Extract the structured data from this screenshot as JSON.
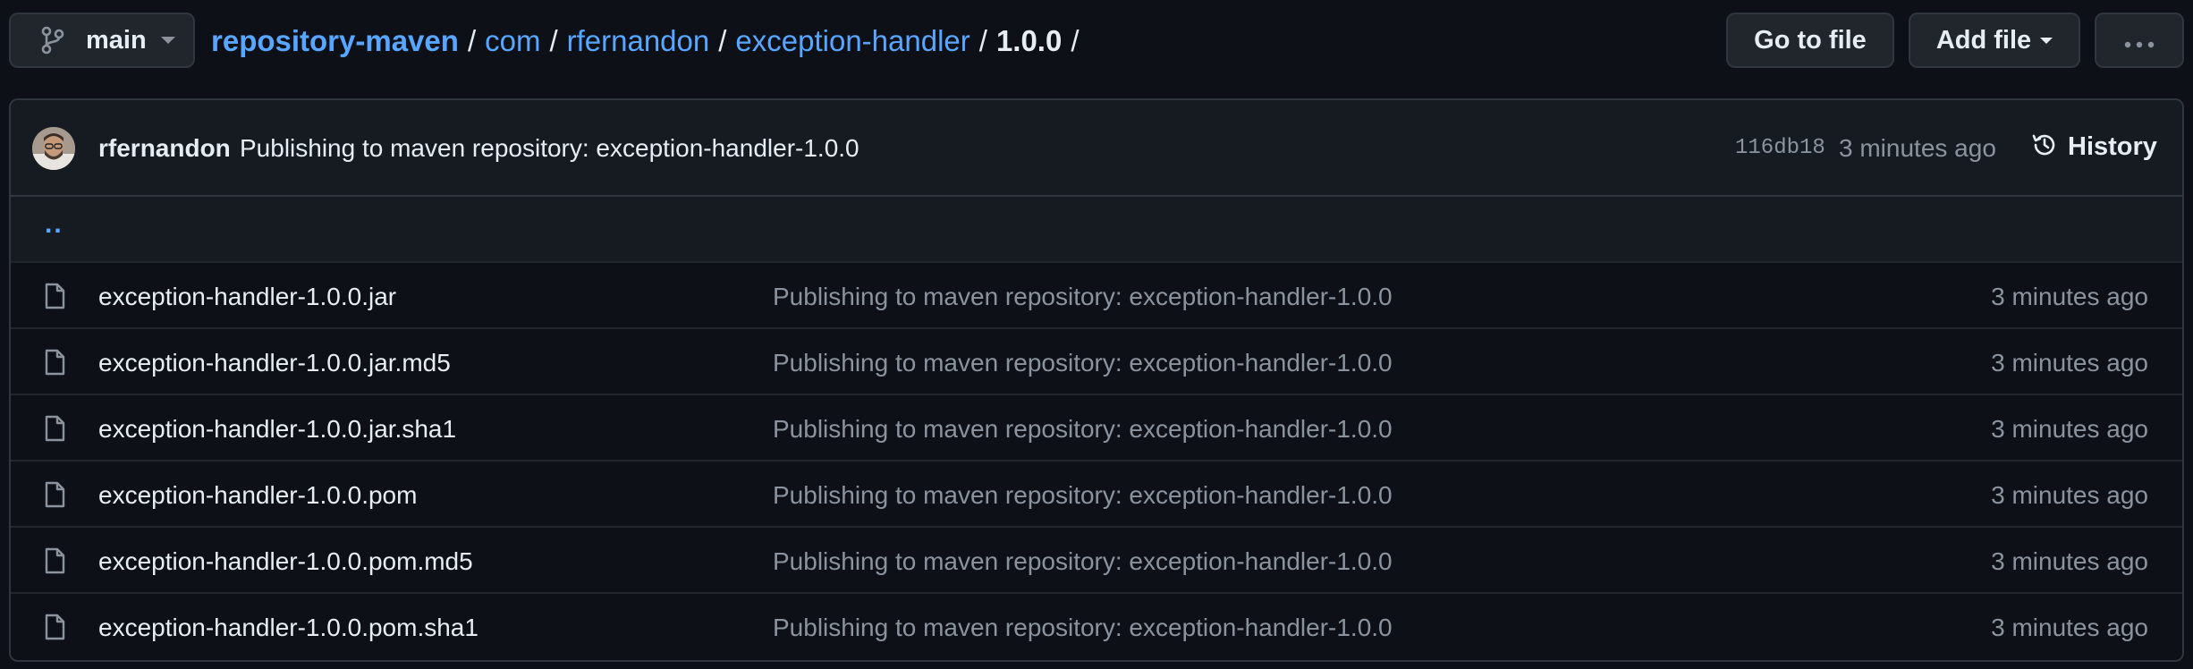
{
  "header": {
    "branch": "main",
    "breadcrumb": [
      {
        "label": "repository-maven",
        "kind": "repo"
      },
      {
        "label": "com",
        "kind": "dir"
      },
      {
        "label": "rfernandon",
        "kind": "dir"
      },
      {
        "label": "exception-handler",
        "kind": "dir"
      }
    ],
    "current_dir": "1.0.0",
    "separator": "/",
    "go_to_file_label": "Go to file",
    "add_file_label": "Add file",
    "more_label": "···"
  },
  "commit": {
    "author": "rfernandon",
    "message": "Publishing to maven repository: exception-handler-1.0.0",
    "sha": "116db18",
    "time": "3 minutes ago",
    "history_label": "History"
  },
  "parent_dir_label": "..",
  "files": [
    {
      "name": "exception-handler-1.0.0.jar",
      "message": "Publishing to maven repository: exception-handler-1.0.0",
      "time": "3 minutes ago"
    },
    {
      "name": "exception-handler-1.0.0.jar.md5",
      "message": "Publishing to maven repository: exception-handler-1.0.0",
      "time": "3 minutes ago"
    },
    {
      "name": "exception-handler-1.0.0.jar.sha1",
      "message": "Publishing to maven repository: exception-handler-1.0.0",
      "time": "3 minutes ago"
    },
    {
      "name": "exception-handler-1.0.0.pom",
      "message": "Publishing to maven repository: exception-handler-1.0.0",
      "time": "3 minutes ago"
    },
    {
      "name": "exception-handler-1.0.0.pom.md5",
      "message": "Publishing to maven repository: exception-handler-1.0.0",
      "time": "3 minutes ago"
    },
    {
      "name": "exception-handler-1.0.0.pom.sha1",
      "message": "Publishing to maven repository: exception-handler-1.0.0",
      "time": "3 minutes ago"
    }
  ],
  "icons": {
    "branch": "git-branch-icon",
    "caret": "triangle-down-icon",
    "history": "history-clock-icon",
    "file": "file-icon",
    "more": "kebab-horizontal-icon"
  },
  "colors": {
    "background": "#0d1117",
    "surface": "#161b22",
    "border": "#30363d",
    "link": "#58a6ff",
    "text": "#e6edf3",
    "muted": "#8b949e"
  }
}
